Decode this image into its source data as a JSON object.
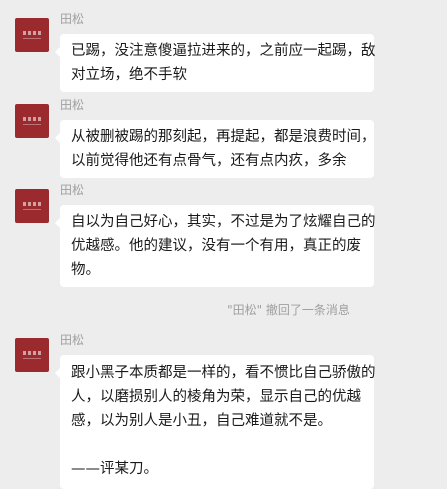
{
  "messages": [
    {
      "sender": "田松",
      "lines": [
        "已踢，没注意傻逼拉进来的，之前应一起踢，敌",
        "对立场，绝不手软"
      ]
    },
    {
      "sender": "田松",
      "lines": [
        "从被删被踢的那刻起，再提起，都是浪费时间，",
        "以前觉得他还有点骨气，还有点内疚，多余"
      ]
    },
    {
      "sender": "田松",
      "lines": [
        "自以为自己好心，其实，不过是为了炫耀自己的",
        "优越感。他的建议，没有一个有用，真正的废",
        "物。"
      ]
    },
    {
      "sender": "田松",
      "lines": [
        "跟小黑子本质都是一样的，看不惯比自己骄傲的",
        "人，以磨损别人的棱角为荣，显示自己的优越",
        "感，以为别人是小丑，自己难道就不是。",
        "",
        "——评某刀。"
      ]
    }
  ],
  "recall_notice": "\"田松\" 撤回了一条消息"
}
